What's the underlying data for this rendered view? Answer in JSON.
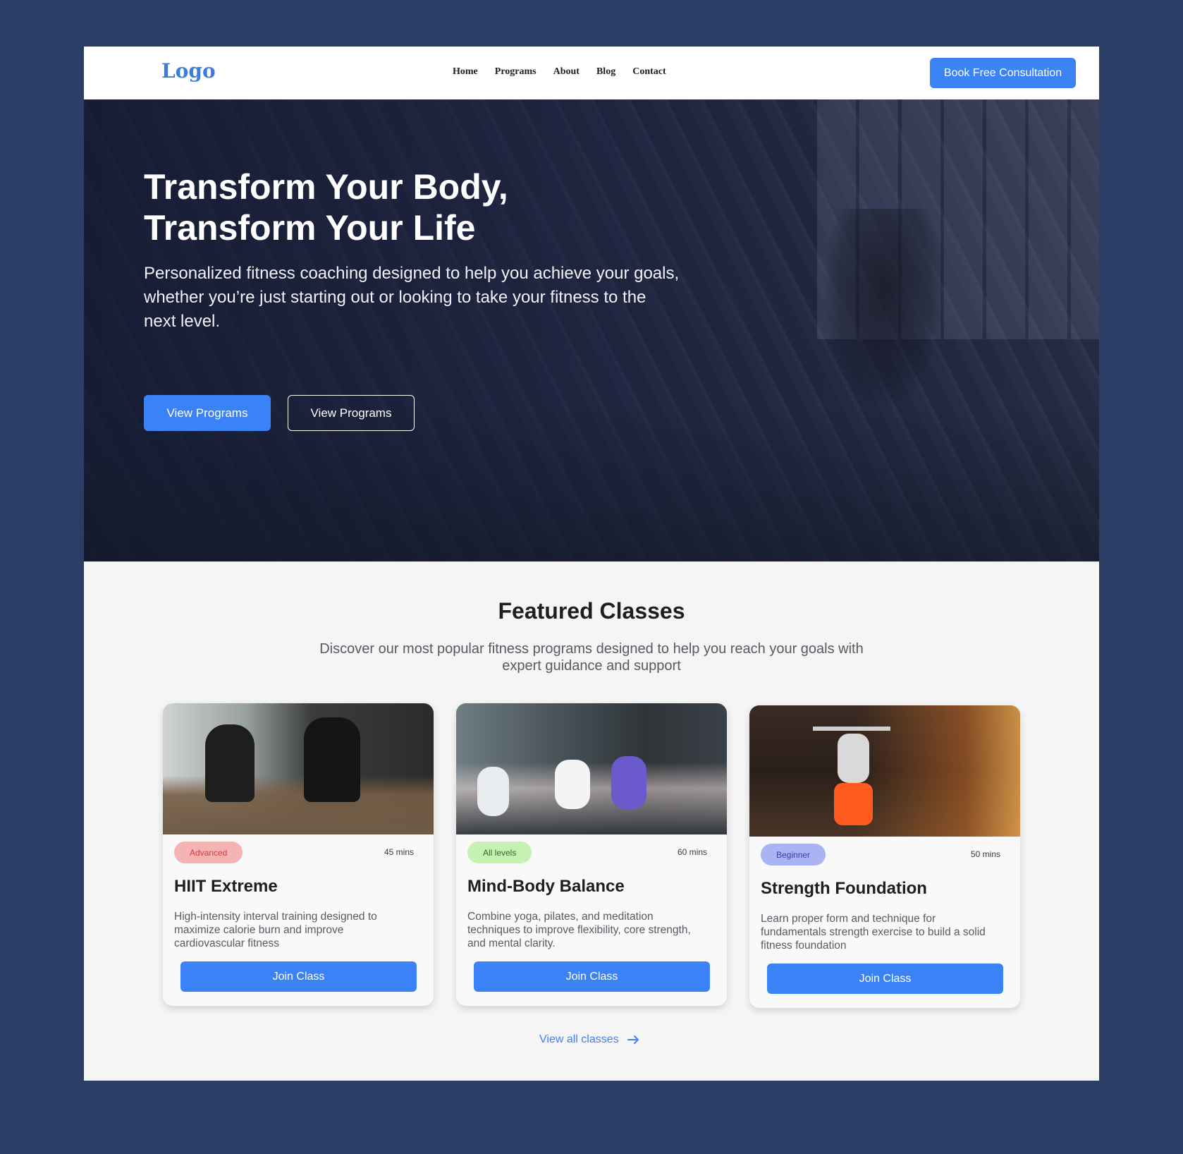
{
  "nav": {
    "logo": "Logo",
    "links": [
      "Home",
      "Programs",
      "About",
      "Blog",
      "Contact"
    ],
    "cta": "Book Free Consultation"
  },
  "hero": {
    "title": "Transform  Your Body,\nTransform Your Life",
    "subtitle": "Personalized fitness coaching designed to help you achieve your goals, whether you’re just starting out or looking to take your fitness to the next level.",
    "primary_button": "View Programs",
    "secondary_button": "View Programs"
  },
  "featured": {
    "title": "Featured Classes",
    "subtitle": "Discover our most popular fitness programs designed to help you reach your goals with expert guidance and support",
    "cards": [
      {
        "level": "Advanced",
        "duration": "45 mins",
        "title": "HIIT Extreme",
        "description": "High-intensity interval training designed to maximize calorie burn and improve cardiovascular fitness",
        "button": "Join Class"
      },
      {
        "level": "All levels",
        "duration": "60 mins",
        "title": "Mind-Body Balance",
        "description": "Combine yoga, pilates, and meditation techniques to improve flexibility, core strength, and mental clarity.",
        "button": "Join Class"
      },
      {
        "level": "Beginner",
        "duration": "50 mins",
        "title": "Strength Foundation",
        "description": "Learn proper form and technique for fundamentals strength exercise to build a solid fitness foundation",
        "button": "Join Class"
      }
    ],
    "view_all": "View all classes",
    "view_all_icon": "arrow-right-icon"
  },
  "colors": {
    "background": "#2c3e66",
    "accent": "#3b82f6",
    "badge_advanced": "#f4b4b4",
    "badge_all_levels": "#c5f1b3",
    "badge_beginner": "#aab3f3"
  }
}
